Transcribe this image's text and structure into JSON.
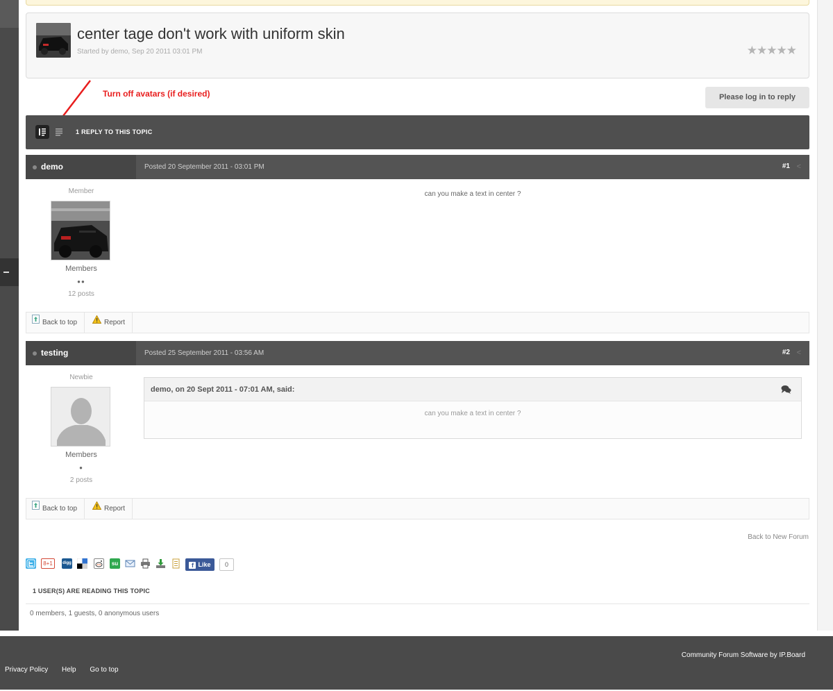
{
  "topic": {
    "title": "center tage don't work with uniform skin",
    "started_by": "Started by demo, Sep 20 2011 03:01 PM",
    "rating_stars": "★★★★★"
  },
  "annotation": {
    "text": "Turn off avatars (if desired)",
    "color": "#e81d1d"
  },
  "reply_button": "Please log in to reply",
  "reply_bar": {
    "count_label": "1 REPLY TO THIS TOPIC"
  },
  "posts": [
    {
      "author": "demo",
      "date": "Posted 20 September 2011 - 03:01 PM",
      "number": "#1",
      "user_title": "Member",
      "group": "Members",
      "pips": "●●",
      "post_count": "12 posts",
      "content": "can you make a text in center ?",
      "avatar": "car-photo"
    },
    {
      "author": "testing",
      "date": "Posted 25 September 2011 - 03:56 AM",
      "number": "#2",
      "user_title": "Newbie",
      "group": "Members",
      "pips": "●",
      "post_count": "2 posts",
      "quote": {
        "citation": "demo, on 20 Sept 2011 - 07:01 AM, said:",
        "text": "can you make a text in center ?"
      },
      "avatar": "default-person"
    }
  ],
  "post_actions": {
    "back_to_top": "Back to top",
    "report": "Report"
  },
  "back_to_forum": "Back to New Forum",
  "share": {
    "google_plus": "8+1",
    "digg": "digg",
    "stumble": "su",
    "fb_like": "Like",
    "fb_count": "0"
  },
  "readers": {
    "title": "1 USER(S) ARE READING THIS TOPIC",
    "detail": "0 members, 1 guests, 0 anonymous users"
  },
  "footer": {
    "powered_by": "Community Forum Software by IP.Board",
    "links": [
      "Privacy Policy",
      "Help",
      "Go to top"
    ]
  }
}
